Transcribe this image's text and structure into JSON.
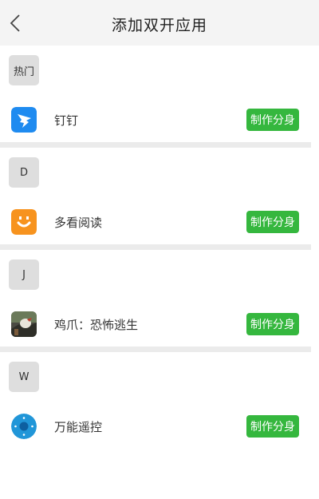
{
  "header": {
    "title": "添加双开应用",
    "back_icon": "chevron-left-icon"
  },
  "colors": {
    "header_bg": "#f4f4f4",
    "divider": "#ebebeb",
    "badge_bg": "#dedede",
    "button": "#35b73e"
  },
  "sections": [
    {
      "label": "热门",
      "app": {
        "name": "钉钉",
        "icon": "dingtalk-icon",
        "action": "制作分身"
      }
    },
    {
      "label": "D",
      "app": {
        "name": "多看阅读",
        "icon": "duokan-icon",
        "action": "制作分身"
      }
    },
    {
      "label": "J",
      "app": {
        "name": "鸡爪：恐怖逃生",
        "icon": "game-icon",
        "action": "制作分身"
      }
    },
    {
      "label": "W",
      "app": {
        "name": "万能遥控",
        "icon": "remote-control-icon",
        "action": "制作分身"
      }
    }
  ]
}
